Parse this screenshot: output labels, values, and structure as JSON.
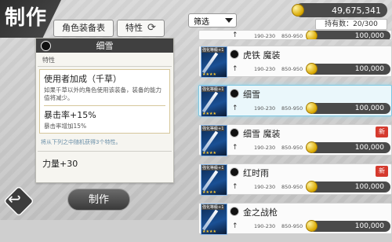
{
  "title": "制作",
  "tabs": {
    "equip_table": "角色装备表",
    "trait": "特性"
  },
  "panel": {
    "name": "细雪",
    "attr_label": "特性",
    "traits": [
      {
        "head": "使用者加成（千草）",
        "desc": "如果千草以外的角色使用该装备，装备的能力值将减少。"
      },
      {
        "head": "暴击率+15%",
        "desc": "暴击率增加15%"
      }
    ],
    "note": "将从下列之中随机获得3个特性。",
    "stat": "力量+30"
  },
  "make_button": "制作",
  "gold": "49,675,341",
  "holding": "持有数：20/300",
  "filter": "筛选",
  "items": [
    {
      "name": "",
      "range1": "190-230",
      "range2": "850-950",
      "price": "100,000"
    },
    {
      "name": "虎铁 魔装",
      "range1": "190-230",
      "range2": "850-950",
      "price": "100,000",
      "new": ""
    },
    {
      "name": "细雪",
      "range1": "190-230",
      "range2": "850-950",
      "price": "100,000",
      "selected": true,
      "new": ""
    },
    {
      "name": "细雪 魔装",
      "range1": "190-230",
      "range2": "850-950",
      "price": "100,000",
      "new": "新"
    },
    {
      "name": "红时雨",
      "range1": "190-230",
      "range2": "850-950",
      "price": "100,000",
      "new": "新"
    },
    {
      "name": "金之战枪",
      "range1": "190-230",
      "range2": "850-950",
      "price": "100,000",
      "new": ""
    }
  ],
  "thumb_tag": "強化等級+1"
}
